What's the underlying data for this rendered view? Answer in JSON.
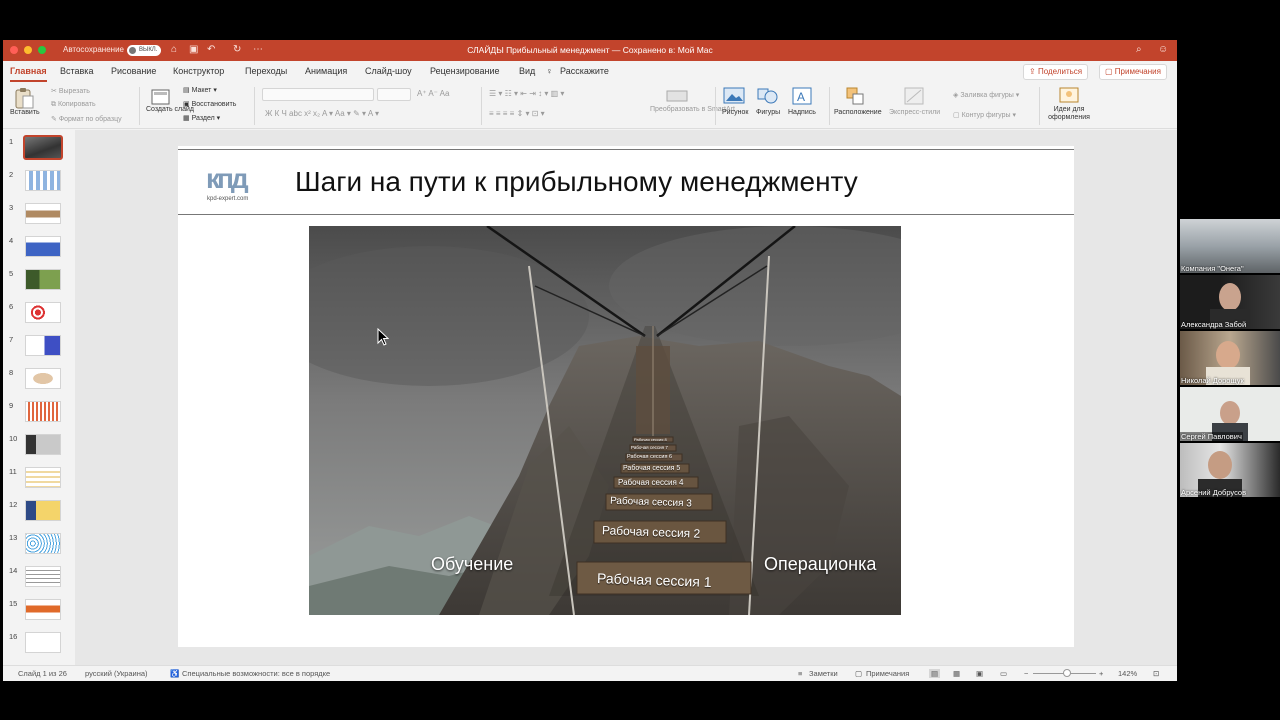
{
  "titlebar": {
    "autosave_label": "Автосохранение",
    "autosave_state": "ВЫКЛ.",
    "document_title": "СЛАЙДЫ Прибыльный менеджмент — Сохранено в: Мой Mac",
    "icons": [
      "home-icon",
      "save-icon",
      "undo-icon",
      "redo-icon",
      "more-icon",
      "search-icon",
      "share-people-icon"
    ]
  },
  "tabs": [
    "Главная",
    "Вставка",
    "Рисование",
    "Конструктор",
    "Переходы",
    "Анимация",
    "Слайд-шоу",
    "Рецензирование",
    "Вид"
  ],
  "tell_me": "Расскажите",
  "share_button": "Поделиться",
  "comments_button": "Примечания",
  "ribbon": {
    "paste": "Вставить",
    "cut": "Вырезать",
    "copy": "Копировать",
    "format_painter": "Формат по образцу",
    "new_slide": "Создать слайд",
    "layout": "Макет",
    "reset": "Восстановить",
    "section": "Раздел",
    "convert_smartart": "Преобразовать в SmartArt",
    "picture": "Рисунок",
    "shapes": "Фигуры",
    "textbox": "Надпись",
    "arrange": "Расположение",
    "express_styles": "Экспресс-стили",
    "shape_fill": "Заливка фигуры",
    "shape_outline": "Контур фигуры",
    "design_ideas": "Идеи для оформления"
  },
  "thumbnails": [
    "1",
    "2",
    "3",
    "4",
    "5",
    "6",
    "7",
    "8",
    "9",
    "10",
    "11",
    "12",
    "13",
    "14",
    "15",
    "16"
  ],
  "selected_slide": 1,
  "slide": {
    "logo_url": "kpd-expert.com",
    "title": "Шаги на пути к прибыльному менеджменту",
    "left_label": "Обучение",
    "right_label": "Операционка",
    "planks": [
      "Рабочая сессия 1",
      "Рабочая сессия 2",
      "Рабочая сессия 3",
      "Рабочая сессия 4",
      "Рабочая сессия 5",
      "Рабочая сессия 6",
      "Рабочая сессия 7",
      "Рабочая сессия 8"
    ]
  },
  "status": {
    "slide_counter": "Слайд 1 из 26",
    "language": "русский (Украина)",
    "accessibility": "Специальные возможности: все в порядке",
    "notes": "Заметки",
    "comments": "Примечания",
    "zoom": "142%"
  },
  "participants": [
    "Компания \"Онега\"",
    "Александра Забой",
    "Николай Дорощук",
    "Сергей Павлович",
    "Арсений Добрусов"
  ],
  "colors": {
    "accent": "#c2442c",
    "titlebar": "#c2442c"
  }
}
